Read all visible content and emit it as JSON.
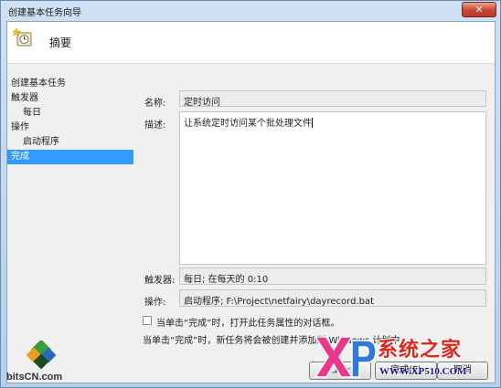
{
  "window": {
    "title": "创建基本任务向导",
    "close_symbol": "✕"
  },
  "header": {
    "title": "摘要",
    "icon": "task-wizard-clock-icon"
  },
  "nav": {
    "items": [
      {
        "label": "创建基本任务",
        "sub": false,
        "active": false
      },
      {
        "label": "触发器",
        "sub": false,
        "active": false
      },
      {
        "label": "每日",
        "sub": true,
        "active": false
      },
      {
        "label": "操作",
        "sub": false,
        "active": false
      },
      {
        "label": "启动程序",
        "sub": true,
        "active": false
      },
      {
        "label": "完成",
        "sub": false,
        "active": true
      }
    ]
  },
  "form": {
    "name_label": "名称:",
    "name_value": "定时访问",
    "desc_label": "描述:",
    "desc_value": "让系统定时访问某个批处理文件",
    "trigger_label": "触发器:",
    "trigger_value": "每日; 在每天的 0:10",
    "action_label": "操作:",
    "action_value": "启动程序; F:\\Project\\netfairy\\dayrecord.bat",
    "checkbox_label": "当单击“完成”时，打开此任务属性的对话框。",
    "checkbox_checked": false,
    "note": "当单击“完成”时，新任务将会被创建并添加到 Windows 计划中"
  },
  "buttons": {
    "back": "< 上一步",
    "finish": "完成(F)",
    "cancel": "取消"
  },
  "watermarks": {
    "left_text": "bitsCN.com",
    "right_title": "系统之家",
    "right_url": "WWW.XP510.COM"
  },
  "colors": {
    "active_nav": "#3399ff",
    "close_button": "#c7452f",
    "watermark_red": "#e0261d"
  }
}
